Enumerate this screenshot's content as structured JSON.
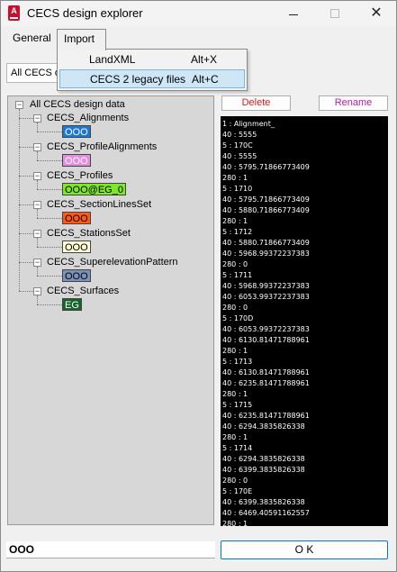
{
  "window": {
    "title": "CECS design explorer",
    "controls": {
      "minimize": "—",
      "maximize": "☐",
      "close": "✕"
    }
  },
  "tabs": [
    {
      "label": "General"
    },
    {
      "label": "Import"
    }
  ],
  "combo": {
    "value": "All CECS d"
  },
  "import_menu": [
    {
      "label": "LandXML",
      "shortcut": "Alt+X"
    },
    {
      "label": "CECS 2 legacy files",
      "shortcut": "Alt+C"
    }
  ],
  "tree": {
    "root": "All CECS design data",
    "nodes": [
      {
        "label": "CECS_Alignments",
        "child": "OOO",
        "color": "#1f77d4",
        "text_color": "#ffffff"
      },
      {
        "label": "CECS_ProfileAlignments",
        "child": "OOO",
        "color": "#e58ee0",
        "text_color": "#ffffff"
      },
      {
        "label": "CECS_Profiles",
        "child": "OOO@EG_0",
        "color": "#7ee827",
        "text_color": "#000000"
      },
      {
        "label": "CECS_SectionLinesSet",
        "child": "OOO",
        "color": "#ff5a14",
        "text_color": "#000000"
      },
      {
        "label": "CECS_StationsSet",
        "child": "OOO",
        "color": "#fffbd6",
        "text_color": "#000000"
      },
      {
        "label": "CECS_SuperelevationPattern",
        "child": "OOO",
        "color": "#7b91b8",
        "text_color": "#000000"
      },
      {
        "label": "CECS_Surfaces",
        "child": "EG",
        "color": "#17642a",
        "text_color": "#ffffff"
      }
    ]
  },
  "buttons": {
    "delete": "Delete",
    "rename": "Rename",
    "ok": "O K"
  },
  "output_lines": [
    "1 : Alignment_",
    "40 : 5555",
    "5 : 170C",
    "40 : 5555",
    "40 : 5795.71866773409",
    "280 : 1",
    "5 : 1710",
    "40 : 5795.71866773409",
    "40 : 5880.71866773409",
    "280 : 1",
    "5 : 1712",
    "40 : 5880.71866773409",
    "40 : 5968.99372237383",
    "280 : 0",
    "5 : 1711",
    "40 : 5968.99372237383",
    "40 : 6053.99372237383",
    "280 : 0",
    "5 : 170D",
    "40 : 6053.99372237383",
    "40 : 6130.81471788961",
    "280 : 1",
    "5 : 1713",
    "40 : 6130.81471788961",
    "40 : 6235.81471788961",
    "280 : 1",
    "5 : 1715",
    "40 : 6235.81471788961",
    "40 : 6294.3835826338",
    "280 : 1",
    "5 : 1714",
    "40 : 6294.3835826338",
    "40 : 6399.3835826338",
    "280 : 0",
    "5 : 170E",
    "40 : 6399.3835826338",
    "40 : 6469.40591162557",
    "280 : 1"
  ],
  "status": {
    "value": "OOO"
  }
}
